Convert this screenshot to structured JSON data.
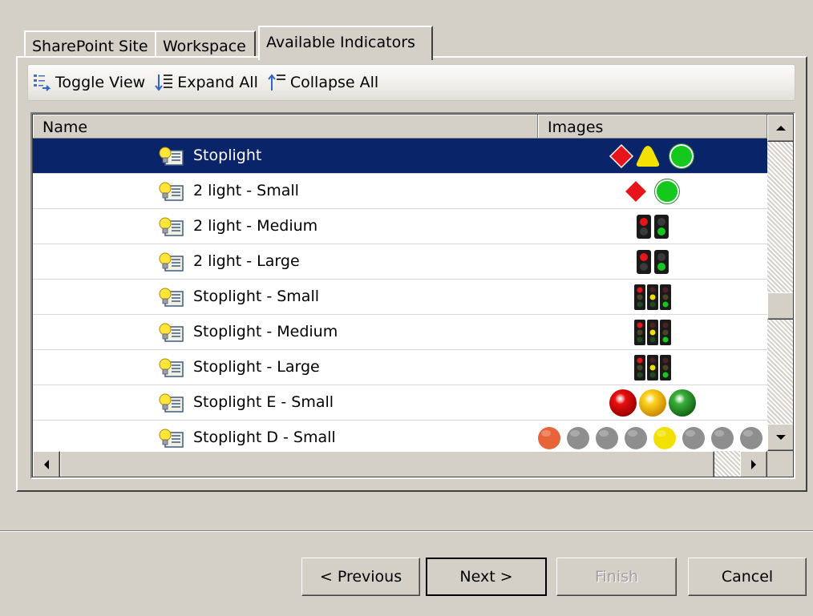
{
  "tabs": [
    {
      "label": "SharePoint Site"
    },
    {
      "label": "Workspace"
    },
    {
      "label": "Available Indicators"
    }
  ],
  "toolbar": {
    "toggle_view": "Toggle View",
    "expand_all": "Expand All",
    "collapse_all": "Collapse All"
  },
  "grid": {
    "columns": {
      "name": "Name",
      "images": "Images"
    },
    "rows": [
      {
        "label": "Stoplight",
        "selected": true,
        "images": "shapes-3"
      },
      {
        "label": "2 light - Small",
        "images": "shapes-2"
      },
      {
        "label": "2 light - Medium",
        "images": "lights-2"
      },
      {
        "label": "2 light - Large",
        "images": "lights-2"
      },
      {
        "label": "Stoplight - Small",
        "images": "lights-3"
      },
      {
        "label": "Stoplight - Medium",
        "images": "lights-3"
      },
      {
        "label": "Stoplight - Large",
        "images": "lights-3"
      },
      {
        "label": "Stoplight E - Small",
        "images": "balls-3"
      },
      {
        "label": "Stoplight D - Small",
        "images": "balls-9"
      }
    ]
  },
  "buttons": {
    "previous": "< Previous",
    "next": "Next >",
    "finish": "Finish",
    "cancel": "Cancel"
  },
  "colors": {
    "selection": "#0a246a",
    "red": "#e8141c",
    "yellow": "#f2e100",
    "green": "#14c81e",
    "orange": "#e8633a",
    "gray": "#8e8e8e"
  }
}
